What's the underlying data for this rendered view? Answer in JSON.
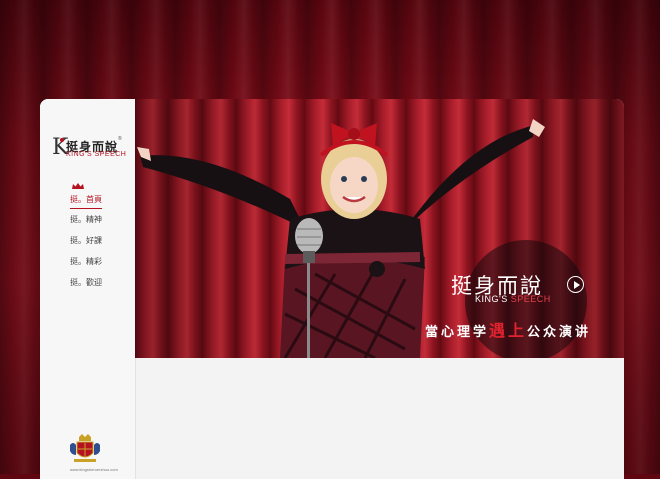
{
  "brand": {
    "logo_k": "K",
    "name_cn": "挺身而說",
    "name_en": "KING'S SPEECH",
    "reg": "®"
  },
  "nav": {
    "items": [
      {
        "label": "挺。首頁",
        "active": true
      },
      {
        "label": "挺。精神",
        "active": false
      },
      {
        "label": "挺。好課",
        "active": false
      },
      {
        "label": "挺。精彩",
        "active": false
      },
      {
        "label": "挺。歡迎",
        "active": false
      }
    ]
  },
  "hero": {
    "title": "挺身而說",
    "subtitle_en_1": "KING'S ",
    "subtitle_en_2": "SPEECH",
    "tagline_1": "當心理学",
    "tagline_red": "遇上",
    "tagline_2": "公众演讲",
    "play_icon": "play-circle-icon"
  },
  "footer": {
    "url": "www.kingsheroershuo.com",
    "crest_icon": "crest-icon"
  },
  "colors": {
    "accent": "#b41220",
    "curtain": "#a51323",
    "card_bg": "#f3f3f3"
  }
}
